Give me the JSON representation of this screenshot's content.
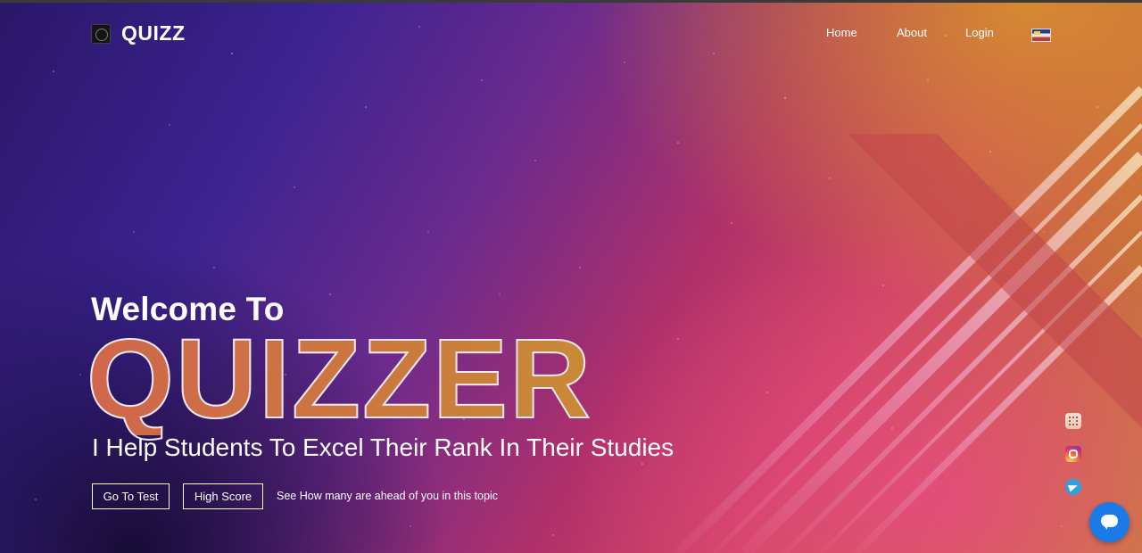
{
  "brand": {
    "name": "QUIZZ",
    "logo_icon": "quizz-logo-icon"
  },
  "nav": {
    "items": [
      {
        "label": "Home"
      },
      {
        "label": "About"
      },
      {
        "label": "Login"
      }
    ],
    "language_icon": "flag-icon"
  },
  "hero": {
    "welcome": "Welcome To",
    "title": "QUIZZER",
    "tagline": "I Help Students To Excel Their Rank In Their Studies"
  },
  "actions": {
    "go_to_test": "Go To Test",
    "high_score": "High Score",
    "hint": "See How many are ahead of you in this topic"
  },
  "social": {
    "icons": [
      "link-icon",
      "instagram-icon",
      "telegram-icon"
    ]
  },
  "chat": {
    "icon": "chat-bubble-icon"
  }
}
